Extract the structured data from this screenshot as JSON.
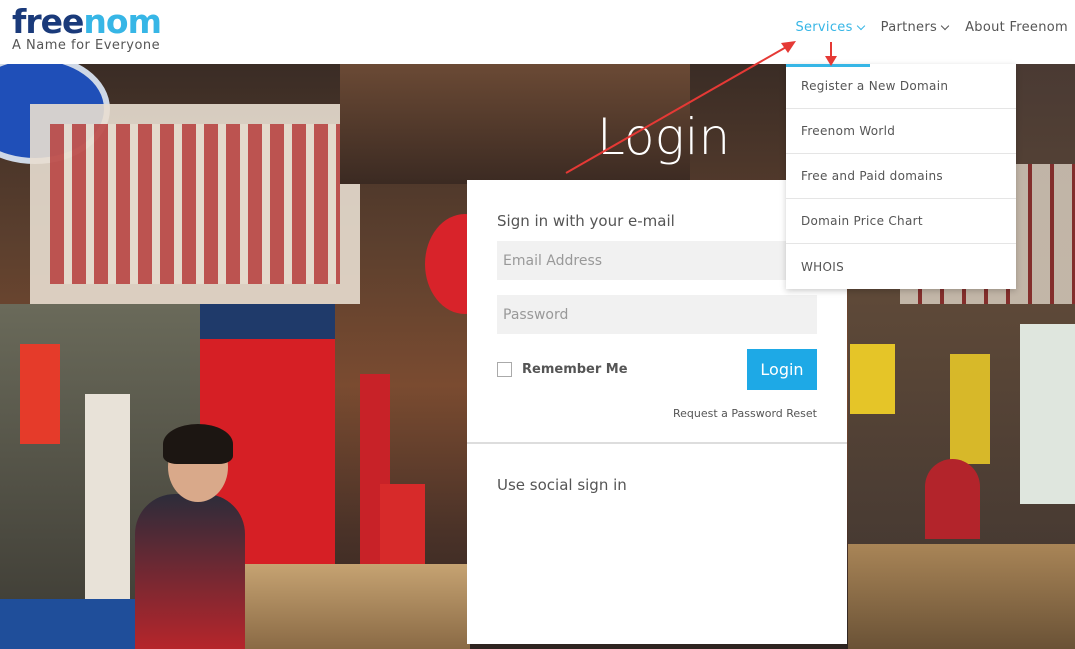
{
  "header": {
    "logo_text_dark": "free",
    "logo_text_accent": "nom",
    "tagline": "A Name for Everyone",
    "nav": [
      {
        "label": "Services"
      },
      {
        "label": "Partners"
      },
      {
        "label": "About Freenom"
      }
    ]
  },
  "dropdown": {
    "items": [
      {
        "label": "Register a New Domain"
      },
      {
        "label": "Freenom World"
      },
      {
        "label": "Free and Paid domains"
      },
      {
        "label": "Domain Price Chart"
      },
      {
        "label": "WHOIS"
      }
    ]
  },
  "login": {
    "title": "Login",
    "email_heading": "Sign in with your e-mail",
    "email_placeholder": "Email Address",
    "password_placeholder": "Password",
    "remember_label": "Remember Me",
    "button_label": "Login",
    "reset_link": "Request a Password Reset",
    "social_heading": "Use social sign in"
  },
  "colors": {
    "accent": "#37b6e6",
    "button": "#1ea9e6",
    "logo_dark": "#1a3a7a",
    "annotation": "#e53935"
  }
}
